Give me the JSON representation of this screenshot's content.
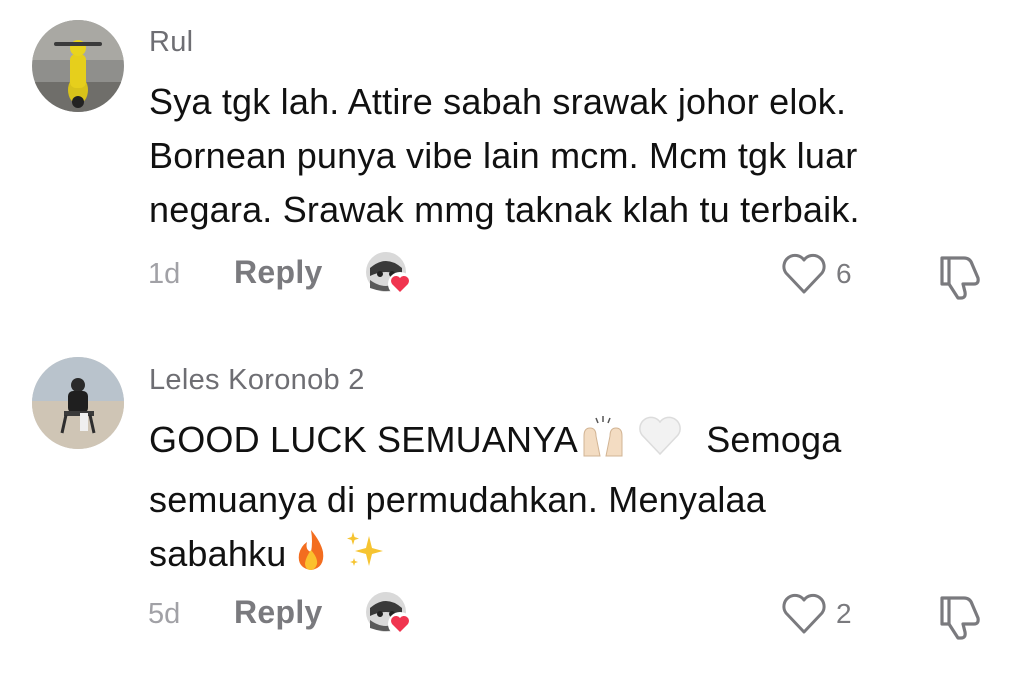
{
  "comments": [
    {
      "username": "Rul",
      "line1": "Sya tgk lah. Attire sabah srawak johor elok.",
      "line2": "Bornean punya vibe lain mcm. Mcm tgk luar",
      "line3": "negara. Srawak mmg taknak klah tu terbaik.",
      "time": "1d",
      "reply_label": "Reply",
      "likes": "6",
      "avatar_icon": "avatar-yellow-scooter",
      "creator_liked": true
    },
    {
      "username": "Leles Koronob 2",
      "text_part1": "GOOD LUCK SEMUANYA",
      "text_part2": "Semoga",
      "line2": "semuanya di permudahkan. Menyalaa",
      "text_part3": "sabahku",
      "emojis": [
        "raising-hands-emoji",
        "white-heart-emoji",
        "fire-emoji",
        "sparkles-emoji"
      ],
      "time": "5d",
      "reply_label": "Reply",
      "likes": "2",
      "avatar_icon": "avatar-beach-chair",
      "creator_liked": true
    }
  ],
  "colors": {
    "text": "#111111",
    "username": "#6e6e73",
    "muted": "#a1a1a6",
    "reply": "#7a7a7e",
    "heart_red": "#f0344f"
  }
}
